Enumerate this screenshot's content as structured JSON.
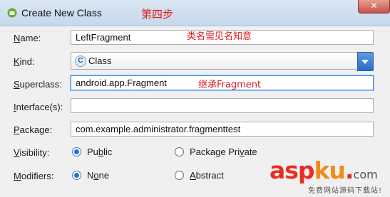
{
  "window": {
    "title": "Create New Class",
    "close_label": "✕",
    "step_annotation": "第四步"
  },
  "form": {
    "name": {
      "label": "Name:",
      "mnemonic": "N",
      "rest": "ame:",
      "value": "LeftFragment",
      "annotation": "类名需见名知意"
    },
    "kind": {
      "label": "Kind:",
      "mnemonic": "K",
      "rest": "ind:",
      "value": "Class",
      "badge": "C"
    },
    "superclass": {
      "label": "Superclass:",
      "mnemonic": "S",
      "rest": "uperclass:",
      "value": "android.app.Fragment",
      "annotation": "继承Fragment"
    },
    "interfaces": {
      "label": "Interface(s):",
      "mnemonic": "I",
      "rest": "nterface(s):",
      "value": ""
    },
    "package": {
      "label": "Package:",
      "mnemonic": "P",
      "rest": "ackage:",
      "value": "com.example.administrator.fragmenttest"
    },
    "visibility": {
      "label": "Visibility:",
      "mnemonic": "V",
      "rest": "isibility:",
      "options": [
        {
          "label": "Public",
          "mnemonic": "b",
          "before": "Pu",
          "after": "lic",
          "selected": true
        },
        {
          "label": "Package Private",
          "mnemonic": "v",
          "before": "Package Pri",
          "after": "ate",
          "selected": false
        }
      ]
    },
    "modifiers": {
      "label": "Modifiers:",
      "mnemonic": "M",
      "rest": "odifiers:",
      "options": [
        {
          "label": "None",
          "mnemonic": "o",
          "before": "N",
          "after": "ne",
          "selected": true
        },
        {
          "label": "Abstract",
          "mnemonic": "A",
          "before": "",
          "after": "bstract",
          "selected": false
        }
      ]
    }
  },
  "watermark": {
    "asp": "asp",
    "ku": "ku",
    "dot": ".",
    "com": "com",
    "tagline": "免费网站源码下载站!"
  },
  "icons": {
    "app": "android-studio-icon",
    "dropdown": "chevron-down-icon"
  },
  "colors": {
    "annotation": "#e0191b",
    "accent": "#2a6fe0",
    "titlebar": "#c7d8ec"
  }
}
